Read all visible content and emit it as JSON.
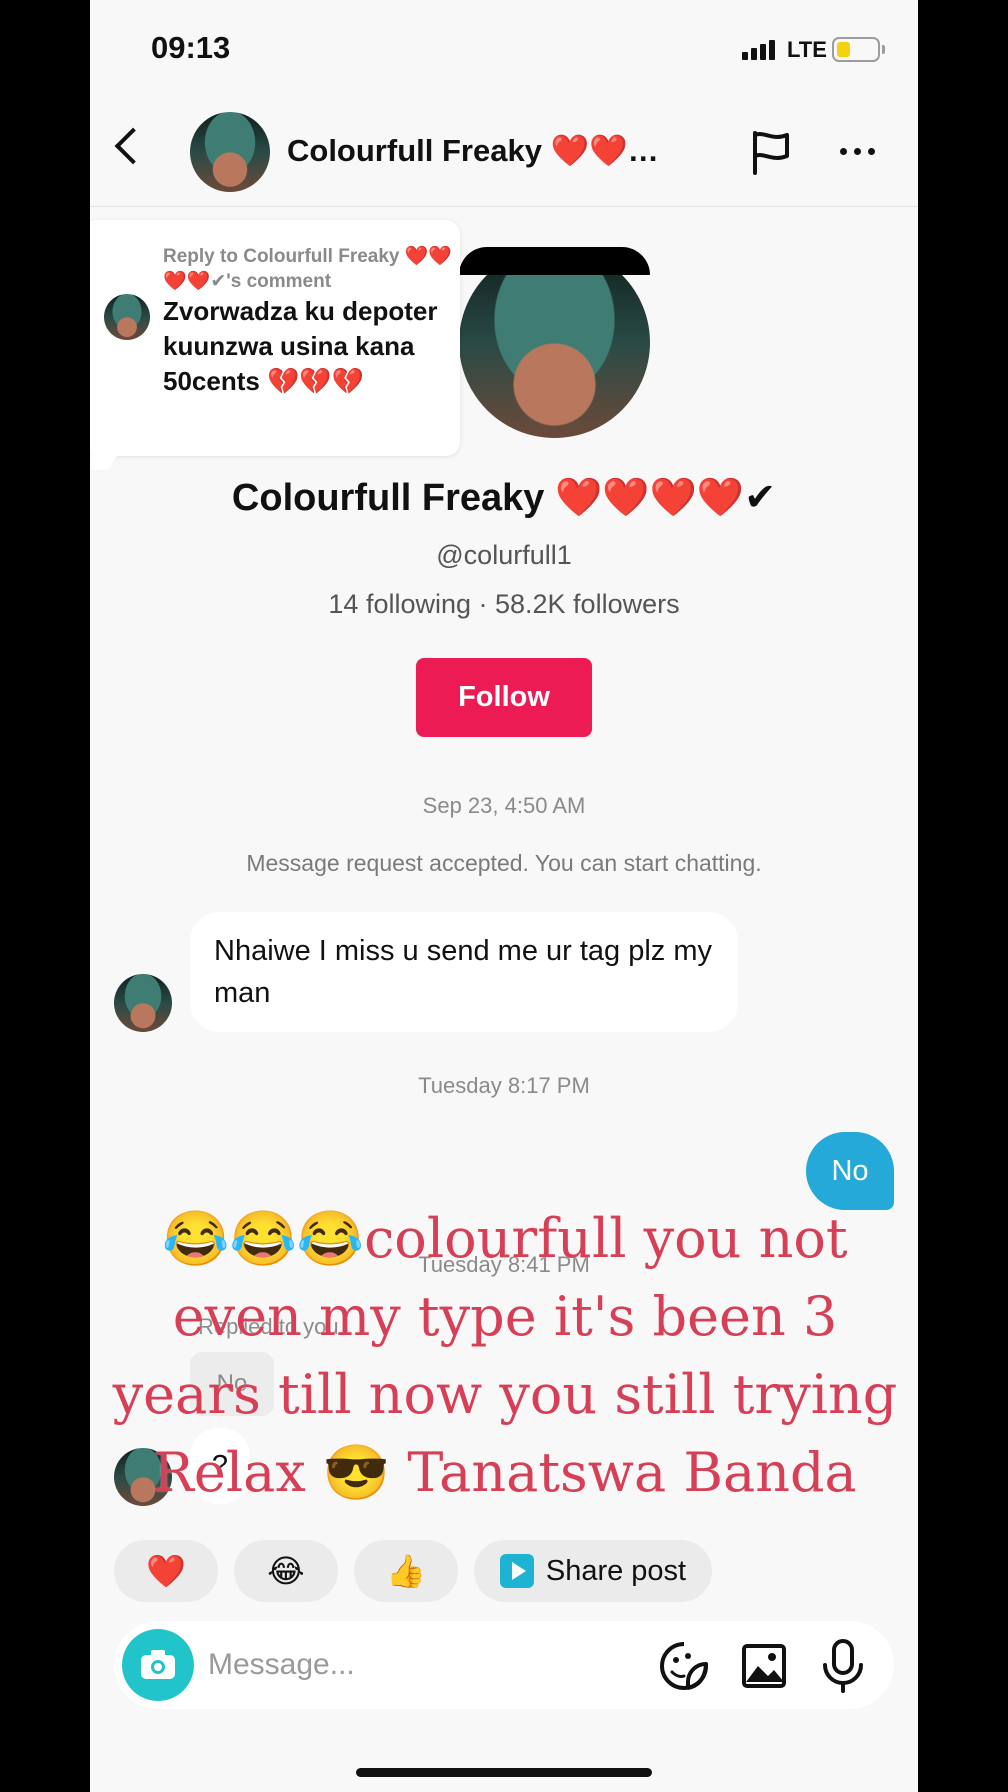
{
  "status_bar": {
    "time": "09:13",
    "network": "LTE",
    "battery_level": 0.25,
    "battery_color": "#f4d20e"
  },
  "header": {
    "title": "Colourfull Freaky ❤️❤️❤️❤️✔",
    "back_icon": "chevron-left-icon",
    "report_icon": "flag-icon",
    "more_icon": "more-horizontal-icon"
  },
  "reply_card": {
    "meta": "Reply to Colourfull Freaky ❤️❤️❤️❤️✔'s comment",
    "text": "Zvorwadza ku depoter kuunzwa usina kana 50cents 💔💔💔"
  },
  "profile": {
    "name": "Colourfull Freaky ❤️❤️❤️❤️✔",
    "handle": "@colurfull1",
    "stats": "14 following · 58.2K followers",
    "follow_label": "Follow",
    "follow_color": "#ec1b54"
  },
  "conversation": {
    "timestamp_1": "Sep 23, 4:50 AM",
    "system_message": "Message request accepted. You can start chatting.",
    "incoming_1": "Nhaiwe I miss u send me ur tag plz my man",
    "timestamp_2": "Tuesday 8:17 PM",
    "outgoing_1": "No",
    "timestamp_3": "Tuesday 8:41 PM",
    "replied_label": "Replied to you",
    "quoted_reply": "No",
    "incoming_2": "?"
  },
  "overlay_caption": "😂😂😂colourfull you not even my type it's been 3 years till now you still trying Relax 😎 Tanatswa Banda",
  "quick_reactions": {
    "heart": "❤️",
    "laugh": "😂",
    "thumbs_up": "👍",
    "share_label": "Share post"
  },
  "composer": {
    "placeholder": "Message...",
    "camera_icon": "camera-icon",
    "sticker_icon": "sticker-icon",
    "image_icon": "image-icon",
    "mic_icon": "microphone-icon"
  },
  "colors": {
    "outgoing_bubble": "#25a9d9",
    "camera_button": "#22c4cc",
    "overlay_text": "#d63f55"
  }
}
